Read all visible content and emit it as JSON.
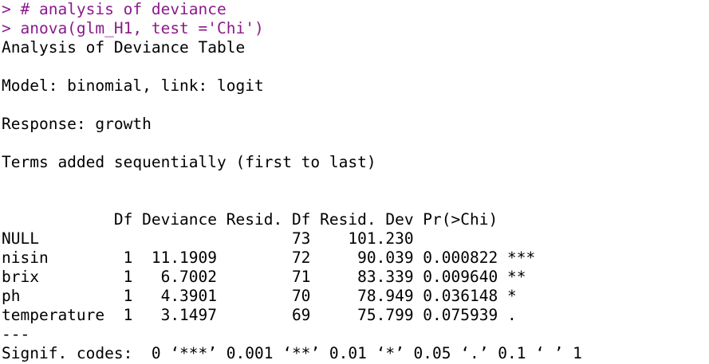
{
  "colors": {
    "input_text": "#8b1a8b",
    "output_text": "#000000",
    "background": "#ffffff"
  },
  "console": {
    "input_lines": [
      "> # analysis of deviance",
      "> anova(glm_H1, test ='Chi')"
    ],
    "title": "Analysis of Deviance Table",
    "model": "Model: binomial, link: logit",
    "response": "Response: growth",
    "terms_note": "Terms added sequentially (first to last)",
    "table_header": "            Df Deviance Resid. Df Resid. Dev Pr(>Chi)    ",
    "table_rows": [
      "NULL                           73    101.230             ",
      "nisin        1  11.1909        72     90.039 0.000822 ***",
      "brix         1   6.7002        71     83.339 0.009640 ** ",
      "ph           1   4.3901        70     78.949 0.036148 *  ",
      "temperature  1   3.1497        69     75.799 0.075939 .  "
    ],
    "separator": "---",
    "signif_codes": "Signif. codes:  0 ‘***’ 0.001 ‘**’ 0.01 ‘*’ 0.05 ‘.’ 0.1 ‘ ’ 1"
  }
}
